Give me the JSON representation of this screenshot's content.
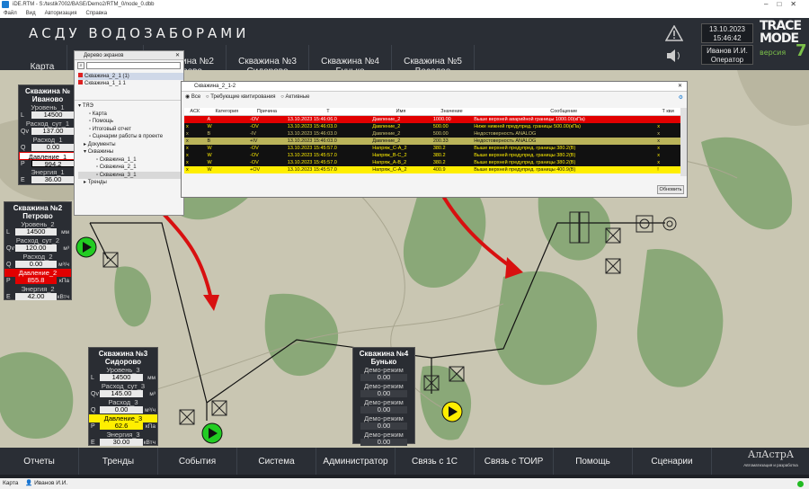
{
  "window": {
    "title": "iDE.RTM - S:/testik7002/BASE/Demo2/RTM_0/node_0.dbb"
  },
  "menu": [
    "Файл",
    "Вид",
    "Авторизация",
    "Справка"
  ],
  "header": {
    "title": "АСДУ ВОДОЗАБОРАМИ",
    "tabs": [
      {
        "l1": "Карта",
        "l2": ""
      },
      {
        "l1": "",
        "l2": ""
      },
      {
        "l1": "Скважина №2",
        "l2": "Петрово"
      },
      {
        "l1": "Скважина №3",
        "l2": "Сидорово"
      },
      {
        "l1": "Скважина №4",
        "l2": "Бунько"
      },
      {
        "l1": "Скважина №5",
        "l2": "Веселое"
      }
    ],
    "date": "13.10.2023",
    "time": "15:46:42",
    "user": "Иванов И.И.",
    "role": "Оператор",
    "logo_l1": "TRACE",
    "logo_l2": "MODE",
    "logo_ver": "версия",
    "logo_num": "7"
  },
  "colors": {
    "accent_green": "#7cc04a",
    "alarm_red": "#e10000",
    "alarm_yellow": "#ffee00",
    "map_bg": "#c9c6b2"
  },
  "wells": {
    "w1": {
      "title1": "Скважина №",
      "title2": "Иваново",
      "level_label": "Уровень_1",
      "L": "14500",
      "flow_label": "Расход_сут_1",
      "Qv": "137.00",
      "rate_label": "Расход_1",
      "Q": "0.00",
      "pressure_label": "Давление_1",
      "P": "994.2",
      "energy_label": "Энергия_1",
      "E": "36.00",
      "L_tag": "L",
      "Qv_tag": "Qv",
      "Q_tag": "Q",
      "P_tag": "P",
      "E_tag": "E"
    },
    "w2": {
      "title1": "Скважина №2",
      "title2": "Петрово",
      "level_label": "Уровень_2",
      "L": "14500",
      "L_unit": "мм",
      "flow_label": "Расход_сут_2",
      "Qv": "120.00",
      "Qv_unit": "м³",
      "rate_label": "Расход_2",
      "Q": "0.00",
      "Q_unit": "м³/ч",
      "pressure_label": "Давление_2",
      "P": "855.8",
      "P_unit": "кПа",
      "energy_label": "Энергия_2",
      "E": "42.00",
      "E_unit": "кВтч",
      "L_tag": "L",
      "Qv_tag": "Qv",
      "Q_tag": "Q",
      "P_tag": "P",
      "E_tag": "E"
    },
    "w3": {
      "title1": "Скважина №3",
      "title2": "Сидорово",
      "level_label": "Уровень_3",
      "L": "14500",
      "L_unit": "мм",
      "flow_label": "Расход_сут_3",
      "Qv": "145.00",
      "Qv_unit": "м³",
      "rate_label": "Расход_3",
      "Q": "0.00",
      "Q_unit": "м³/ч",
      "pressure_label": "Давление_3",
      "P": "62.6",
      "P_unit": "кПа",
      "energy_label": "Энергия_3",
      "E": "30.00",
      "E_unit": "кВтч",
      "L_tag": "L",
      "Qv_tag": "Qv",
      "Q_tag": "Q",
      "P_tag": "P",
      "E_tag": "E"
    },
    "w4": {
      "title1": "Скважина №4",
      "title2": "Бунько",
      "demo": "Демо-режим",
      "v1": "0.00",
      "v2": "0.00",
      "v3": "0.00",
      "v4": "0.00",
      "v5": "0.00"
    }
  },
  "tree": {
    "title": "Дерево экранов",
    "top_items": [
      "Скважина_2_1  (1)",
      "Скважина_1_1  1"
    ],
    "root": "ТЯЭ",
    "items": [
      "Карта",
      "Помощь",
      "Итоговый отчет",
      "Сценарии работы в проекте",
      "Документы",
      "Скважины",
      "Скважина_1_1",
      "Скважина_2_1",
      "Скважина_3_1",
      "Тренды"
    ]
  },
  "alarms": {
    "title": "Скважина_2_1-2",
    "filters": [
      "Все",
      "Требующие квитирования",
      "Активные"
    ],
    "headers": [
      "АСК",
      "Категория",
      "Причина",
      "Т",
      "Имя",
      "Значение",
      "Сообщение",
      "Т кви"
    ],
    "rows": [
      {
        "ack": "",
        "cat": "A",
        "reason": "-OV",
        "t": "13.10.2023 15:46:06.0",
        "name": "Давление_2",
        "value": "1000.00",
        "msg": "Выше верхней аварийной границы 1000.00(кПа)",
        "tack": ""
      },
      {
        "ack": "x",
        "cat": "W",
        "reason": "-OV",
        "t": "13.10.2023 15:46:03.0",
        "name": "Давление_2",
        "value": "500.00",
        "msg": "Ниже нижней предупред. границы 500.00(кПа)",
        "tack": "x"
      },
      {
        "ack": "x",
        "cat": "B",
        "reason": "-IV",
        "t": "13.10.2023 15:46:03.0",
        "name": "Давление_2",
        "value": "500.00",
        "msg": "Недостоверность ANALOG",
        "tack": "x"
      },
      {
        "ack": "x",
        "cat": "B",
        "reason": "+IV",
        "t": "13.10.2023 15:46:03.0",
        "name": "Давление_2",
        "value": "200.33",
        "msg": "Недостоверность ANALOG",
        "tack": "x"
      },
      {
        "ack": "x",
        "cat": "W",
        "reason": "-OV",
        "t": "13.10.2023 15:45:57.0",
        "name": "Напряж_С-А_2",
        "value": "380.2",
        "msg": "Выше верхней предупред. границы 380.2(В)",
        "tack": "x"
      },
      {
        "ack": "x",
        "cat": "W",
        "reason": "-OV",
        "t": "13.10.2023 15:45:57.0",
        "name": "Напряж_В-С_2",
        "value": "380.2",
        "msg": "Выше верхней предупред. границы 380.2(В)",
        "tack": "x"
      },
      {
        "ack": "x",
        "cat": "W",
        "reason": "-OV",
        "t": "13.10.2023 15:45:57.0",
        "name": "Напряж_А-В_2",
        "value": "380.2",
        "msg": "Выше верхней предупред. границы 380.2(В)",
        "tack": "x"
      },
      {
        "ack": "x",
        "cat": "W",
        "reason": "+OV",
        "t": "13.10.2023 15:45:57.0",
        "name": "Напряж_С-А_2",
        "value": "400.9",
        "msg": "Выше верхней предупред. границы 400.9(В)",
        "tack": "!"
      }
    ],
    "refresh": "Обновить"
  },
  "bottom": [
    "Отчеты",
    "Тренды",
    "События",
    "Система",
    "Администратор",
    "Связь с 1С",
    "Связь с ТОИР",
    "Помощь",
    "Сценарии"
  ],
  "brand": {
    "name": "АлАстрА",
    "sub": "Автоматизация и разработка"
  },
  "status": {
    "screen": "Карта",
    "user": "Иванов И.И."
  }
}
